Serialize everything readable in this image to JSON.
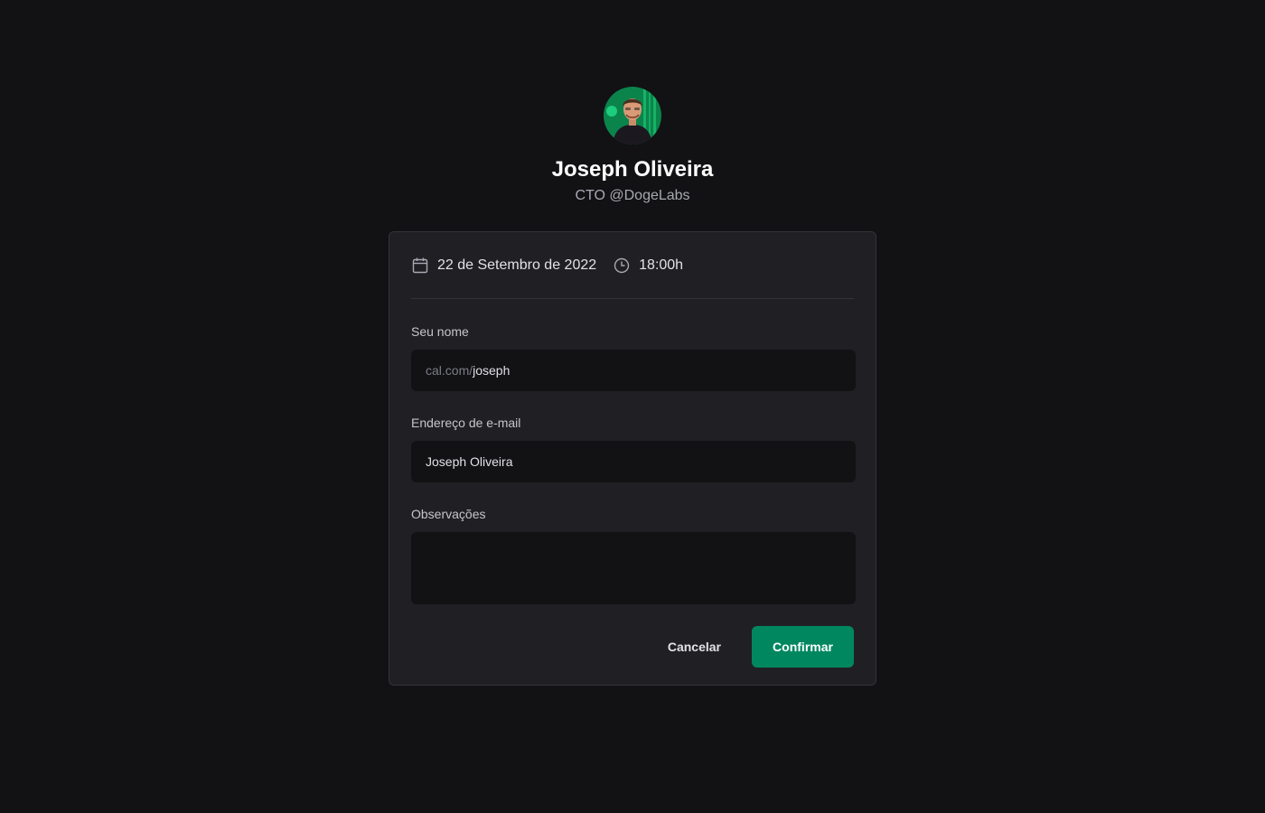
{
  "profile": {
    "name": "Joseph Oliveira",
    "role": "CTO @DogeLabs"
  },
  "schedule": {
    "date": "22 de Setembro de 2022",
    "time": "18:00h"
  },
  "form": {
    "name_label": "Seu nome",
    "name_prefix": "cal.com/",
    "name_value": "joseph",
    "email_label": "Endereço de e-mail",
    "email_value": "Joseph Oliveira",
    "notes_label": "Observações",
    "notes_value": ""
  },
  "actions": {
    "cancel_label": "Cancelar",
    "confirm_label": "Confirmar"
  },
  "colors": {
    "background": "#121214",
    "card": "#202024",
    "input": "#121214",
    "accent": "#00875f"
  },
  "icons": {
    "date": "calendar-icon",
    "time": "clock-icon"
  }
}
